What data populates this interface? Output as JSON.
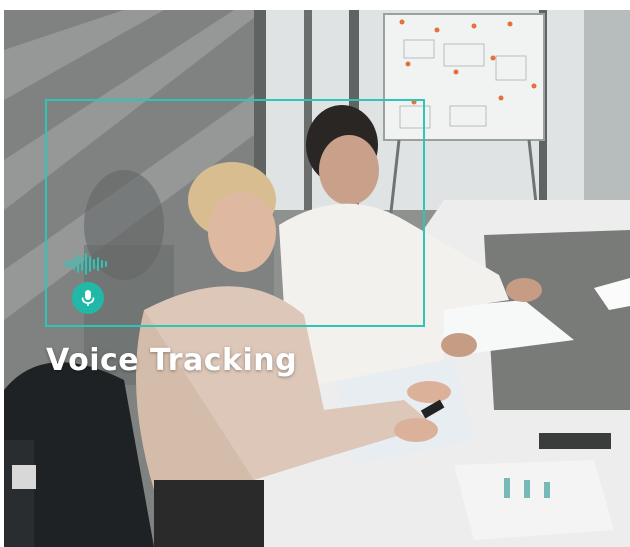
{
  "overlay": {
    "caption": "Voice Tracking",
    "accent_color": "#2ec4b6",
    "icons": [
      "soundwave-icon",
      "microphone-icon"
    ]
  },
  "scene": {
    "description_tags": [
      "meeting-room",
      "two-people",
      "table",
      "whiteboard"
    ]
  }
}
